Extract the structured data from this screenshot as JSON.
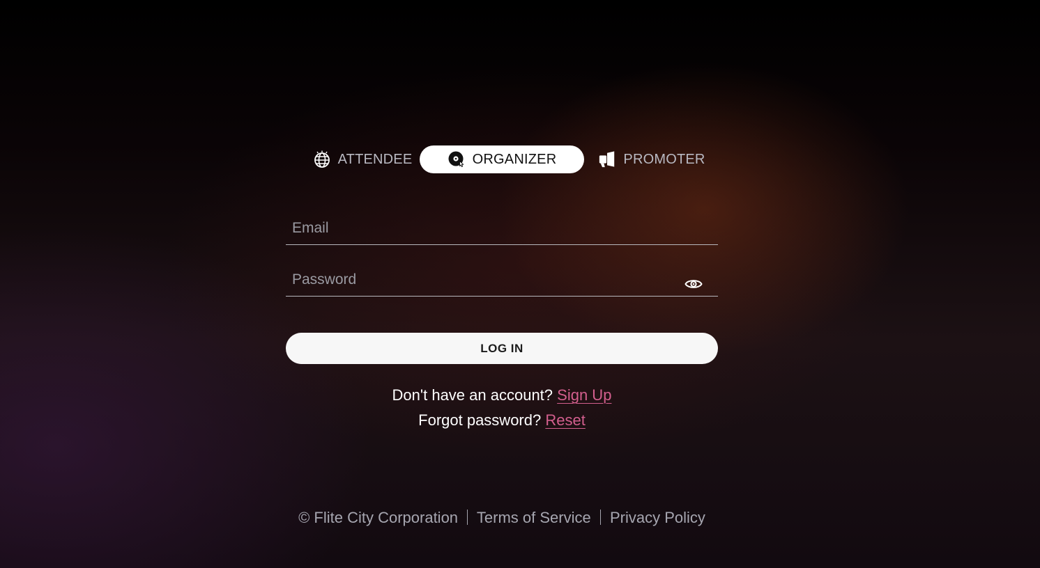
{
  "roles": {
    "attendee": {
      "label": "ATTENDEE",
      "icon": "globe-icon"
    },
    "organizer": {
      "label": "ORGANIZER",
      "icon": "vinyl-record-icon",
      "active": true
    },
    "promoter": {
      "label": "PROMOTER",
      "icon": "megaphone-icon"
    }
  },
  "form": {
    "email_placeholder": "Email",
    "email_value": "",
    "password_placeholder": "Password",
    "password_value": "",
    "toggle_icon": "eye-icon",
    "login_label": "LOG IN"
  },
  "signup": {
    "prompt": "Don't have an account?",
    "link": "Sign Up"
  },
  "reset": {
    "prompt": "Forgot password?",
    "link": "Reset"
  },
  "footer": {
    "copyright": "© Flite City Corporation",
    "terms": "Terms of Service",
    "privacy": "Privacy Policy"
  },
  "colors": {
    "accent_link": "#d35f8e",
    "active_tab_bg": "#ffffff",
    "button_bg": "#f7f7f7"
  }
}
